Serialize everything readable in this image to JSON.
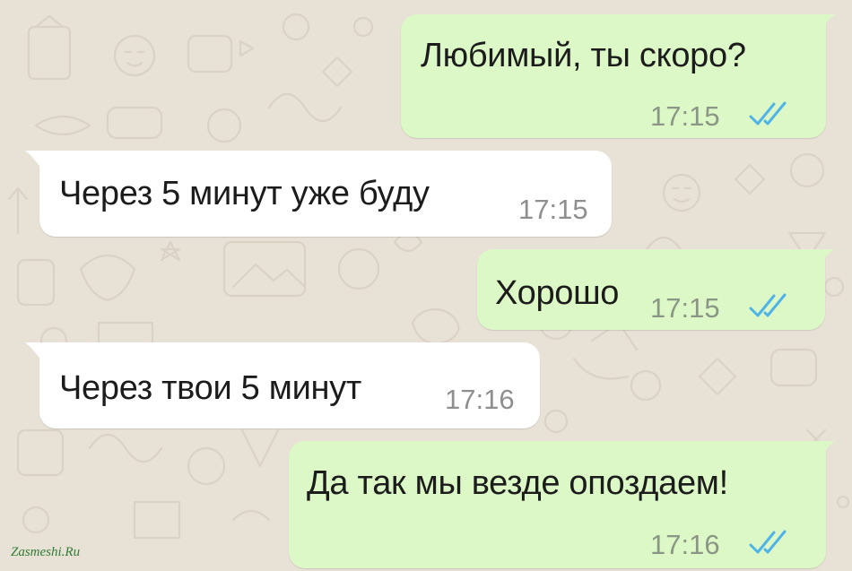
{
  "chat": {
    "messages": [
      {
        "direction": "outgoing",
        "text": "Любимый, ты скоро?",
        "time": "17:15",
        "status": "read"
      },
      {
        "direction": "incoming",
        "text": "Через 5 минут уже буду",
        "time": "17:15"
      },
      {
        "direction": "outgoing",
        "text": "Хорошо",
        "time": "17:15",
        "status": "read"
      },
      {
        "direction": "incoming",
        "text": "Через твои 5 минут",
        "time": "17:16"
      },
      {
        "direction": "outgoing",
        "text": "Да так мы везде опоздаем!",
        "time": "17:16",
        "status": "read"
      }
    ]
  },
  "watermark": "Zasmeshi.Ru",
  "colors": {
    "background": "#e8e1d6",
    "outgoing_bubble": "#dcf8c6",
    "incoming_bubble": "#ffffff",
    "read_ticks": "#4fb3e8"
  },
  "icons": {
    "read_status": "double-check-icon"
  }
}
